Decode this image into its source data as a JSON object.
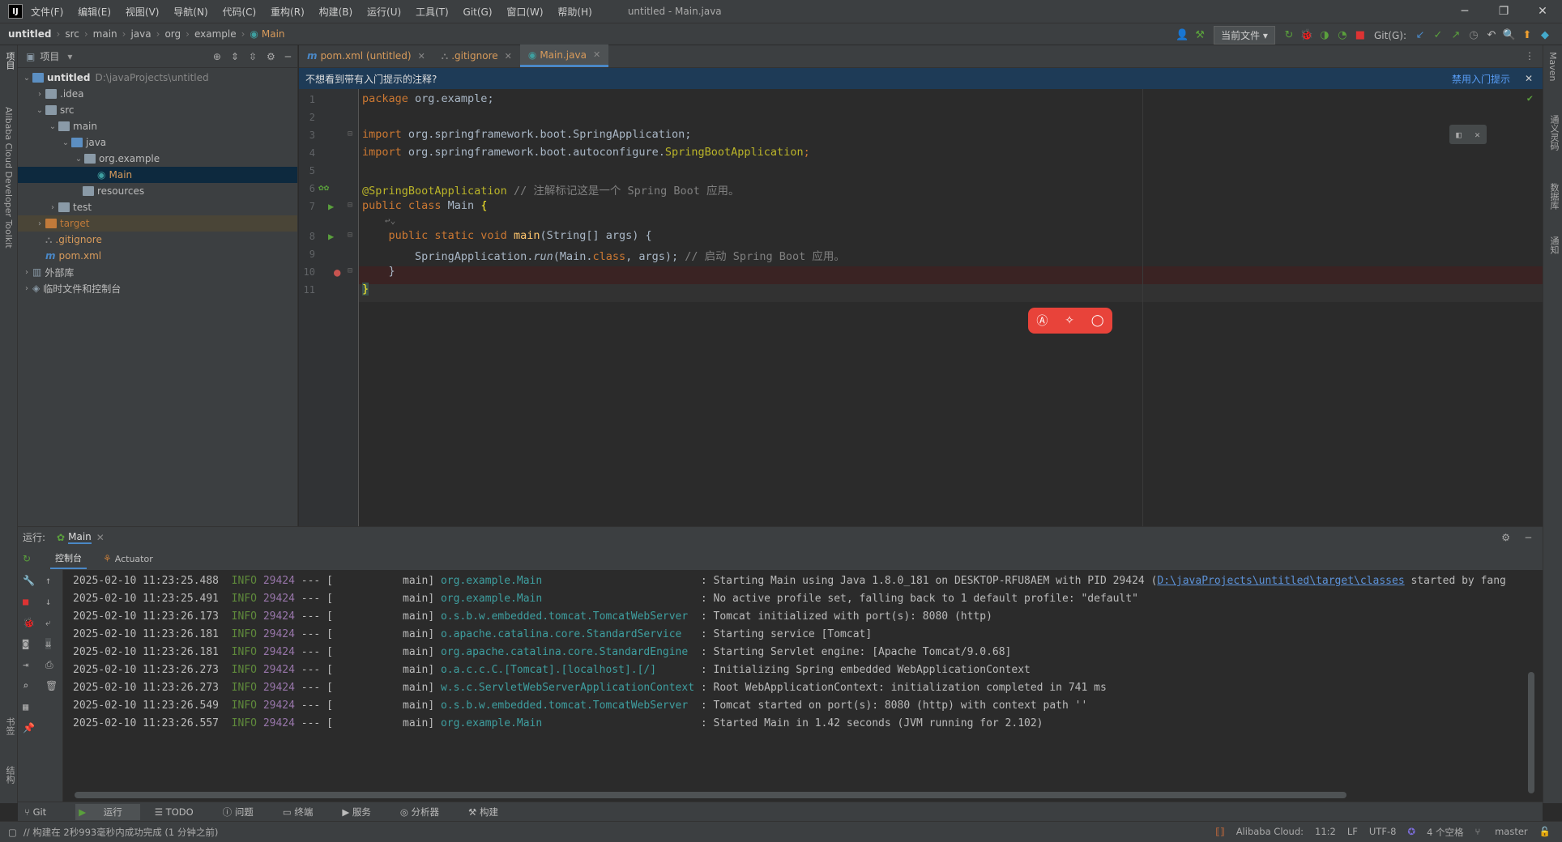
{
  "title_bar": {
    "menus": [
      "文件(F)",
      "编辑(E)",
      "视图(V)",
      "导航(N)",
      "代码(C)",
      "重构(R)",
      "构建(B)",
      "运行(U)",
      "工具(T)",
      "Git(G)",
      "窗口(W)",
      "帮助(H)"
    ],
    "window_title": "untitled - Main.java"
  },
  "nav": {
    "breadcrumbs": [
      "untitled",
      "src",
      "main",
      "java",
      "org",
      "example",
      "Main"
    ],
    "run_config": "当前文件",
    "git_label": "Git(G):"
  },
  "left_strip": {
    "project_label": "项目",
    "toolkit_label": "Alibaba Cloud Developer Toolkit",
    "bookmarks_label": "书签",
    "structure_label": "结构"
  },
  "right_strip": {
    "maven": "Maven",
    "tongyi": "通义灵码",
    "database": "数据库",
    "notifications": "通知"
  },
  "project": {
    "header": "项目",
    "tree": [
      {
        "label": "untitled",
        "extra": "D:\\javaProjects\\untitled",
        "depth": 0
      },
      {
        "label": ".idea",
        "depth": 1
      },
      {
        "label": "src",
        "depth": 1
      },
      {
        "label": "main",
        "depth": 2
      },
      {
        "label": "java",
        "depth": 3
      },
      {
        "label": "org.example",
        "depth": 4
      },
      {
        "label": "Main",
        "depth": 5
      },
      {
        "label": "resources",
        "depth": 3
      },
      {
        "label": "test",
        "depth": 2
      },
      {
        "label": "target",
        "depth": 1
      },
      {
        "label": ".gitignore",
        "depth": 1
      },
      {
        "label": "pom.xml",
        "depth": 1
      },
      {
        "label": "外部库",
        "depth": 0
      },
      {
        "label": "临时文件和控制台",
        "depth": 0
      }
    ]
  },
  "tabs": [
    {
      "label": "pom.xml (untitled)"
    },
    {
      "label": ".gitignore"
    },
    {
      "label": "Main.java"
    }
  ],
  "hint": {
    "text": "不想看到带有入门提示的注释?",
    "disable": "禁用入门提示"
  },
  "editor": {
    "line_numbers": [
      "1",
      "2",
      "3",
      "4",
      "5",
      "6",
      "7",
      "8",
      "9",
      "10",
      "11"
    ],
    "lines": {
      "l1a": "package",
      "l1b": " org.example;",
      "l3a": "import",
      "l3b": " org.springframework.boot.SpringApplication;",
      "l4a": "import",
      "l4b": " org.springframework.boot.autoconfigure.",
      "l4c": "SpringBootApplication",
      "l4d": ";",
      "l6a": "@SpringBootApplication",
      "l6b": " // 注解标记这是一个 Spring Boot 应用。",
      "l7a": "public class",
      "l7b": " Main ",
      "l7c": "{",
      "l7hint": "↩⌄",
      "l8a": "    public static void ",
      "l8b": "main",
      "l8c": "(String[] args) {",
      "l9a": "        SpringApplication.",
      "l9b": "run",
      "l9c": "(Main.",
      "l9d": "class",
      "l9e": ", args); ",
      "l9f": "// 启动 Spring Boot 应用。",
      "l10": "    }",
      "l11": "}"
    }
  },
  "run": {
    "label": "运行:",
    "config": "Main",
    "tabs": [
      "控制台",
      "Actuator"
    ],
    "logs": [
      {
        "ts": "2025-02-10 11:23:25.488",
        "lvl": "INFO",
        "pid": "29424",
        "mid": " --- [           main] ",
        "cls": "org.example.Main                        ",
        "msg": " : Starting Main using Java 1.8.0_181 on DESKTOP-RFU8AEM with PID 29424 (",
        "link": "D:\\javaProjects\\untitled\\target\\classes",
        "tail": " started by fang"
      },
      {
        "ts": "2025-02-10 11:23:25.491",
        "lvl": "INFO",
        "pid": "29424",
        "mid": " --- [           main] ",
        "cls": "org.example.Main                        ",
        "msg": " : No active profile set, falling back to 1 default profile: \"default\""
      },
      {
        "ts": "2025-02-10 11:23:26.173",
        "lvl": "INFO",
        "pid": "29424",
        "mid": " --- [           main] ",
        "cls": "o.s.b.w.embedded.tomcat.TomcatWebServer ",
        "msg": " : Tomcat initialized with port(s): 8080 (http)"
      },
      {
        "ts": "2025-02-10 11:23:26.181",
        "lvl": "INFO",
        "pid": "29424",
        "mid": " --- [           main] ",
        "cls": "o.apache.catalina.core.StandardService  ",
        "msg": " : Starting service [Tomcat]"
      },
      {
        "ts": "2025-02-10 11:23:26.181",
        "lvl": "INFO",
        "pid": "29424",
        "mid": " --- [           main] ",
        "cls": "org.apache.catalina.core.StandardEngine ",
        "msg": " : Starting Servlet engine: [Apache Tomcat/9.0.68]"
      },
      {
        "ts": "2025-02-10 11:23:26.273",
        "lvl": "INFO",
        "pid": "29424",
        "mid": " --- [           main] ",
        "cls": "o.a.c.c.C.[Tomcat].[localhost].[/]      ",
        "msg": " : Initializing Spring embedded WebApplicationContext"
      },
      {
        "ts": "2025-02-10 11:23:26.273",
        "lvl": "INFO",
        "pid": "29424",
        "mid": " --- [           main] ",
        "cls": "w.s.c.ServletWebServerApplicationContext",
        "msg": " : Root WebApplicationContext: initialization completed in 741 ms"
      },
      {
        "ts": "2025-02-10 11:23:26.549",
        "lvl": "INFO",
        "pid": "29424",
        "mid": " --- [           main] ",
        "cls": "o.s.b.w.embedded.tomcat.TomcatWebServer ",
        "msg": " : Tomcat started on port(s): 8080 (http) with context path ''"
      },
      {
        "ts": "2025-02-10 11:23:26.557",
        "lvl": "INFO",
        "pid": "29424",
        "mid": " --- [           main] ",
        "cls": "org.example.Main                        ",
        "msg": " : Started Main in 1.42 seconds (JVM running for 2.102)"
      }
    ]
  },
  "bottom_tools": [
    "Git",
    "运行",
    "TODO",
    "问题",
    "终端",
    "服务",
    "分析器",
    "构建"
  ],
  "status": {
    "message": "// 构建在 2秒993毫秒内成功完成 (1 分钟之前)",
    "cloud": "Alibaba Cloud:",
    "position": "11:2",
    "line_sep": "LF",
    "encoding": "UTF-8",
    "indent": "4 个空格",
    "branch": "master"
  },
  "colors": {
    "accent": "#4a88c7",
    "float_bar": "#e8433a"
  }
}
